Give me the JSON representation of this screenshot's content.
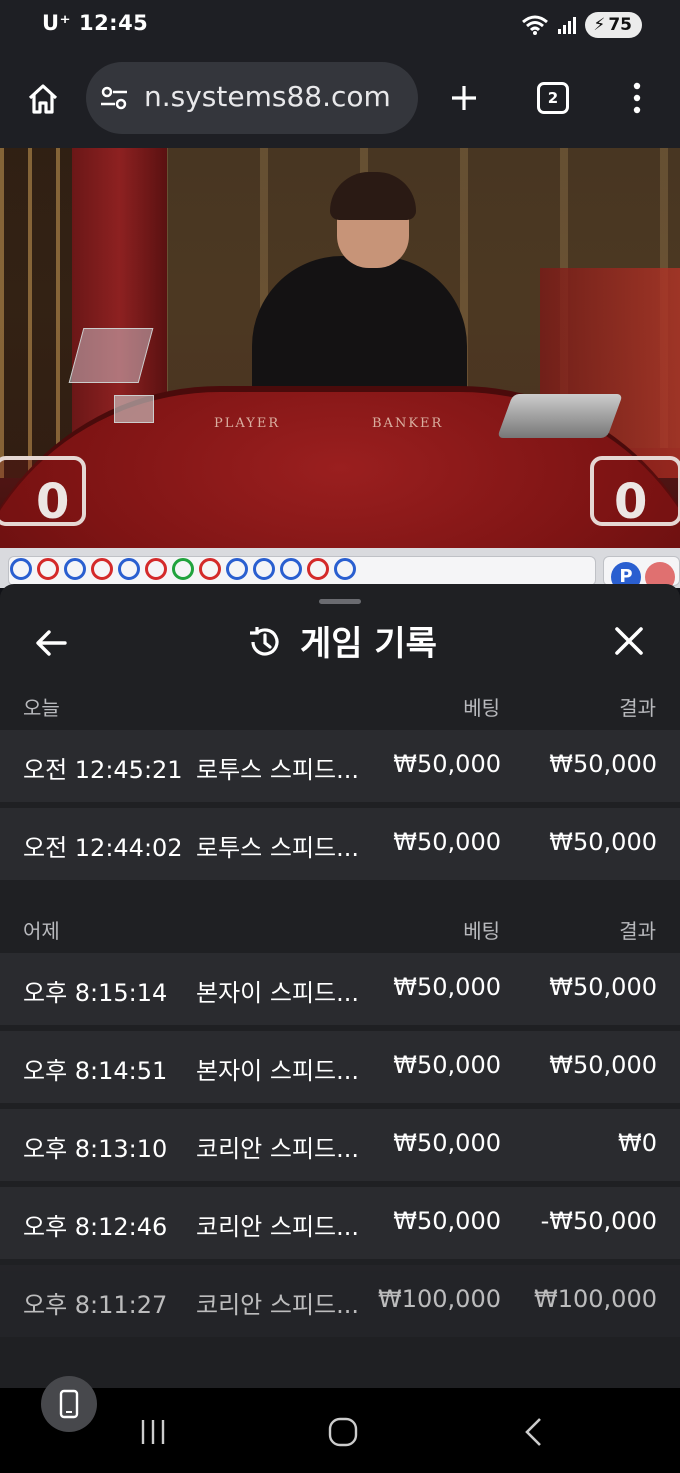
{
  "status": {
    "carrier": "U⁺",
    "time": "12:45",
    "battery": "75"
  },
  "browser": {
    "url": "n.systems88.com",
    "tab_count": "2"
  },
  "video": {
    "player_label": "PLAYER",
    "banker_label": "BANKER",
    "player_score": "0",
    "banker_score": "0"
  },
  "road": {
    "p_label": "P"
  },
  "sheet": {
    "title": "게임 기록",
    "sections": [
      {
        "label": "오늘",
        "bet_header": "베팅",
        "result_header": "결과",
        "rows": [
          {
            "time": "오전 12:45:21",
            "game": "로투스 스피드...",
            "bet": "₩50,000",
            "result": "₩50,000"
          },
          {
            "time": "오전 12:44:02",
            "game": "로투스 스피드...",
            "bet": "₩50,000",
            "result": "₩50,000"
          }
        ]
      },
      {
        "label": "어제",
        "bet_header": "베팅",
        "result_header": "결과",
        "rows": [
          {
            "time": "오후 8:15:14",
            "game": "본자이 스피드...",
            "bet": "₩50,000",
            "result": "₩50,000"
          },
          {
            "time": "오후 8:14:51",
            "game": "본자이 스피드...",
            "bet": "₩50,000",
            "result": "₩50,000"
          },
          {
            "time": "오후 8:13:10",
            "game": "코리안 스피드...",
            "bet": "₩50,000",
            "result": "₩0"
          },
          {
            "time": "오후 8:12:46",
            "game": "코리안 스피드...",
            "bet": "₩50,000",
            "result": "-₩50,000"
          },
          {
            "time": "오후 8:11:27",
            "game": "코리안 스피드...",
            "bet": "₩100,000",
            "result": "₩100,000"
          }
        ]
      }
    ]
  },
  "icons": {
    "home": "home-icon",
    "site_settings": "site-settings-icon",
    "new_tab": "plus-icon",
    "menu": "more-vert-icon",
    "back": "arrow-left-icon",
    "history": "history-icon",
    "close": "close-icon"
  }
}
